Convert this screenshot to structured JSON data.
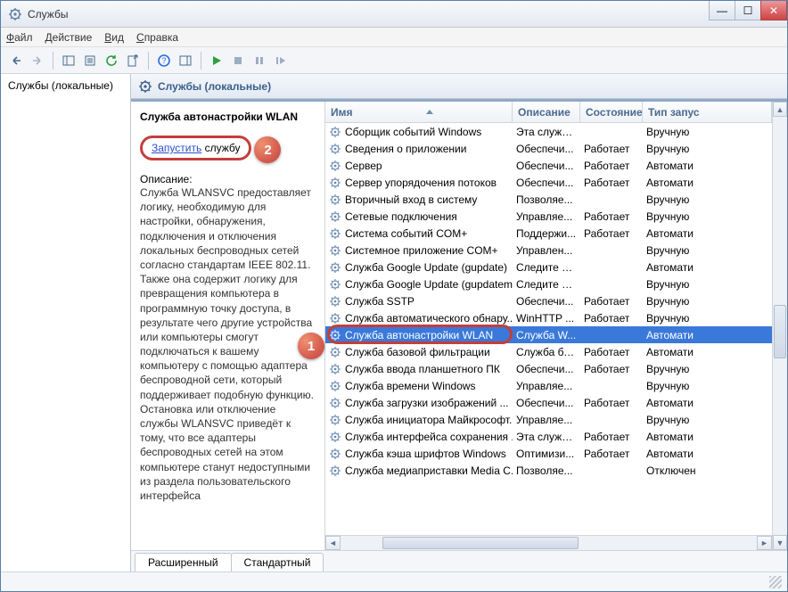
{
  "window": {
    "title": "Службы"
  },
  "menu": {
    "file": "Файл",
    "action": "Действие",
    "view": "Вид",
    "help": "Справка"
  },
  "left": {
    "heading": "Службы (локальные)"
  },
  "rp": {
    "header": "Службы (локальные)",
    "selected_title": "Служба автонастройки WLAN",
    "start_link": "Запустить",
    "start_suffix": " службу",
    "desc_label": "Описание:",
    "desc_body": "Служба WLANSVC предоставляет логику, необходимую для настройки, обнаружения, подключения и отключения локальных беспроводных сетей согласно стандартам IEEE 802.11. Также она содержит логику для превращения компьютера в программную точку доступа, в результате чего другие устройства или компьютеры смогут подключаться к вашему компьютеру с помощью адаптера беспроводной сети, который поддерживает подобную функцию. Остановка или отключение службы WLANSVC приведёт к тому, что все адаптеры беспроводных сетей на этом компьютере станут недоступными из раздела пользовательского интерфейса"
  },
  "cols": {
    "name": "Имя",
    "desc": "Описание",
    "state": "Состояние",
    "start": "Тип запус"
  },
  "rows": [
    {
      "name": "Сборщик событий Windows",
      "desc": "Эта служб...",
      "state": "",
      "start": "Вручную"
    },
    {
      "name": "Сведения о приложении",
      "desc": "Обеспечи...",
      "state": "Работает",
      "start": "Вручную"
    },
    {
      "name": "Сервер",
      "desc": "Обеспечи...",
      "state": "Работает",
      "start": "Автомати"
    },
    {
      "name": "Сервер упорядочения потоков",
      "desc": "Обеспечи...",
      "state": "Работает",
      "start": "Автомати"
    },
    {
      "name": "Вторичный вход в систему",
      "desc": "Позволяе...",
      "state": "",
      "start": "Вручную"
    },
    {
      "name": "Сетевые подключения",
      "desc": "Управляе...",
      "state": "Работает",
      "start": "Вручную"
    },
    {
      "name": "Система событий COM+",
      "desc": "Поддержи...",
      "state": "Работает",
      "start": "Автомати"
    },
    {
      "name": "Системное приложение COM+",
      "desc": "Управлен...",
      "state": "",
      "start": "Вручную"
    },
    {
      "name": "Служба Google Update (gupdate)",
      "desc": "Следите за...",
      "state": "",
      "start": "Автомати"
    },
    {
      "name": "Служба Google Update (gupdatem)",
      "desc": "Следите за...",
      "state": "",
      "start": "Вручную"
    },
    {
      "name": "Служба SSTP",
      "desc": "Обеспечи...",
      "state": "Работает",
      "start": "Вручную"
    },
    {
      "name": "Служба автоматического обнару...",
      "desc": "WinHTTP ...",
      "state": "Работает",
      "start": "Вручную"
    },
    {
      "name": "Служба автонастройки WLAN",
      "desc": "Служба W...",
      "state": "",
      "start": "Автомати",
      "selected": true
    },
    {
      "name": "Служба базовой фильтрации",
      "desc": "Служба ба...",
      "state": "Работает",
      "start": "Автомати"
    },
    {
      "name": "Служба ввода планшетного ПК",
      "desc": "Обеспечи...",
      "state": "Работает",
      "start": "Вручную"
    },
    {
      "name": "Служба времени Windows",
      "desc": "Управляе...",
      "state": "",
      "start": "Вручную"
    },
    {
      "name": "Служба загрузки изображений ...",
      "desc": "Обеспечи...",
      "state": "Работает",
      "start": "Автомати"
    },
    {
      "name": "Служба инициатора Майкрософт...",
      "desc": "Управляе...",
      "state": "",
      "start": "Вручную"
    },
    {
      "name": "Служба интерфейса сохранения ...",
      "desc": "Эта служб...",
      "state": "Работает",
      "start": "Автомати"
    },
    {
      "name": "Служба кэша шрифтов Windows",
      "desc": "Оптимизи...",
      "state": "Работает",
      "start": "Автомати"
    },
    {
      "name": "Служба медиаприставки Media C...",
      "desc": "Позволяе...",
      "state": "",
      "start": "Отключен"
    }
  ],
  "tabs": {
    "extended": "Расширенный",
    "standard": "Стандартный"
  },
  "callouts": {
    "one": "1",
    "two": "2"
  }
}
